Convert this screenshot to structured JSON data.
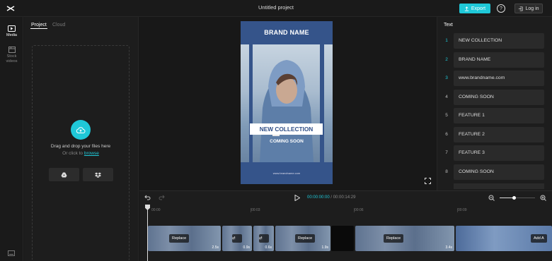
{
  "header": {
    "title": "Untitled project",
    "export_label": "Export",
    "login_label": "Log in",
    "help_label": "?"
  },
  "leftnav": {
    "items": [
      {
        "label": "Media",
        "icon": "media-icon"
      },
      {
        "label": "Stock videos",
        "icon": "stock-videos-icon"
      }
    ]
  },
  "assets": {
    "tabs": [
      "Project",
      "Cloud"
    ],
    "active_tab": "Project",
    "drop_text": "Drag and drop your files here",
    "or_click": "Or click to",
    "browse": "browse",
    "sources": [
      "google-drive-icon",
      "dropbox-icon"
    ]
  },
  "poster": {
    "brand": "BRAND NAME",
    "headline": "NEW COLLECTION",
    "sub": "COMING SOON",
    "url": "www.brandname.com",
    "bg_color": "#35548a"
  },
  "text_panel": {
    "heading": "Text",
    "items": [
      {
        "num": "1",
        "text": "NEW COLLECTION"
      },
      {
        "num": "2",
        "text": "BRAND NAME"
      },
      {
        "num": "3",
        "text": "www.brandname.com"
      },
      {
        "num": "4",
        "text": "COMING SOON"
      },
      {
        "num": "5",
        "text": "FEATURE 1"
      },
      {
        "num": "6",
        "text": "FEATURE 2"
      },
      {
        "num": "7",
        "text": "FEATURE 3"
      },
      {
        "num": "8",
        "text": "COMING SOON"
      }
    ]
  },
  "timeline": {
    "current": "00:00:00:00",
    "separator": "/",
    "total": "00:00:14:29",
    "ticks": [
      "00:00",
      "00:03",
      "00:06",
      "00:09"
    ],
    "clips": [
      {
        "duration": "2.5s",
        "action": "Replace"
      },
      {
        "duration": "0.9s",
        "action": ""
      },
      {
        "duration": "0.6s",
        "action": ""
      },
      {
        "duration": "1.9s",
        "action": "Replace"
      },
      {
        "duration": "3.4s",
        "action": "Replace"
      },
      {
        "duration": "",
        "action": "Add A"
      }
    ],
    "zoom_level": 0.4
  },
  "colors": {
    "accent": "#1fc8d8",
    "background": "#181818",
    "panel": "#1d1d1d"
  }
}
